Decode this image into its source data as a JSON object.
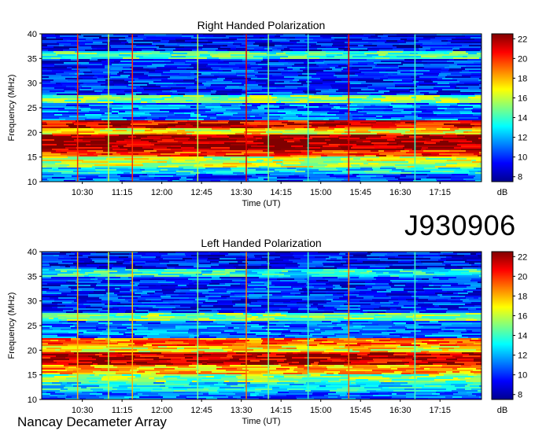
{
  "dataset_id": "J930906",
  "instrument": "Nancay Decameter Array",
  "colorbar": {
    "unit": "dB",
    "ticks": [
      8,
      10,
      12,
      14,
      16,
      18,
      20,
      22
    ],
    "range": [
      7.5,
      22.5
    ],
    "colormap": "jet"
  },
  "chart_data": [
    {
      "type": "heatmap",
      "title": "Right Handed Polarization",
      "xlabel": "Time (UT)",
      "ylabel": "Frequency (MHz)",
      "x_ticks": [
        "10:30",
        "11:15",
        "12:00",
        "12:45",
        "13:30",
        "14:15",
        "15:00",
        "15:45",
        "16:30",
        "17:15"
      ],
      "x_range_min": [
        584,
        1082
      ],
      "y_ticks": [
        10,
        15,
        20,
        25,
        30,
        35,
        40
      ],
      "ylim": [
        10,
        40
      ],
      "value_unit": "dB",
      "zlim": [
        8,
        22
      ],
      "bands_mhz_db": [
        {
          "from": 10,
          "to": 11.5,
          "db": 10.5
        },
        {
          "from": 11.5,
          "to": 13,
          "db": 13
        },
        {
          "from": 13,
          "to": 15,
          "db": 16
        },
        {
          "from": 15,
          "to": 16.5,
          "db": 20
        },
        {
          "from": 16.5,
          "to": 19.5,
          "db": 22
        },
        {
          "from": 19.5,
          "to": 21,
          "db": 17
        },
        {
          "from": 21,
          "to": 22.5,
          "db": 21
        },
        {
          "from": 22.5,
          "to": 26,
          "db": 11
        },
        {
          "from": 26,
          "to": 27.5,
          "db": 15
        },
        {
          "from": 27.5,
          "to": 35,
          "db": 10
        },
        {
          "from": 35,
          "to": 36.5,
          "db": 14
        },
        {
          "from": 36.5,
          "to": 40,
          "db": 9.5
        }
      ],
      "vertical_lines_time_min": [
        {
          "t": 624,
          "db": 20
        },
        {
          "t": 659,
          "db": 16
        },
        {
          "t": 686,
          "db": 20
        },
        {
          "t": 760,
          "db": 16
        },
        {
          "t": 815,
          "db": 21
        },
        {
          "t": 840,
          "db": 15
        },
        {
          "t": 885,
          "db": 14
        },
        {
          "t": 931,
          "db": 21
        },
        {
          "t": 1006,
          "db": 14
        }
      ]
    },
    {
      "type": "heatmap",
      "title": "Left Handed Polarization",
      "xlabel": "Time (UT)",
      "ylabel": "Frequency (MHz)",
      "x_ticks": [
        "10:30",
        "11:15",
        "12:00",
        "12:45",
        "13:30",
        "14:15",
        "15:00",
        "15:45",
        "16:30",
        "17:15"
      ],
      "x_range_min": [
        584,
        1082
      ],
      "y_ticks": [
        10,
        15,
        20,
        25,
        30,
        35,
        40
      ],
      "ylim": [
        10,
        40
      ],
      "value_unit": "dB",
      "zlim": [
        8,
        22
      ],
      "bands_mhz_db": [
        {
          "from": 10,
          "to": 11.5,
          "db": 11
        },
        {
          "from": 11.5,
          "to": 13.5,
          "db": 13
        },
        {
          "from": 13.5,
          "to": 15,
          "db": 15
        },
        {
          "from": 15,
          "to": 17,
          "db": 18
        },
        {
          "from": 17,
          "to": 19.5,
          "db": 21.5
        },
        {
          "from": 19.5,
          "to": 21,
          "db": 17
        },
        {
          "from": 21,
          "to": 22.5,
          "db": 19
        },
        {
          "from": 22.5,
          "to": 26,
          "db": 11
        },
        {
          "from": 26,
          "to": 27.5,
          "db": 15
        },
        {
          "from": 27.5,
          "to": 35,
          "db": 10
        },
        {
          "from": 35,
          "to": 36.5,
          "db": 13.5
        },
        {
          "from": 36.5,
          "to": 40,
          "db": 9.5
        }
      ],
      "vertical_lines_time_min": [
        {
          "t": 624,
          "db": 18
        },
        {
          "t": 659,
          "db": 16
        },
        {
          "t": 686,
          "db": 18
        },
        {
          "t": 760,
          "db": 15
        },
        {
          "t": 815,
          "db": 19
        },
        {
          "t": 840,
          "db": 15
        },
        {
          "t": 885,
          "db": 14
        },
        {
          "t": 931,
          "db": 19
        },
        {
          "t": 1006,
          "db": 14
        }
      ]
    }
  ]
}
